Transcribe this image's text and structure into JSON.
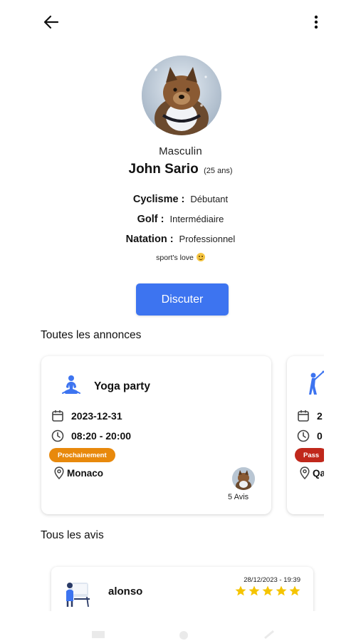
{
  "topbar": {
    "back_icon": "arrow-left-icon",
    "more_icon": "more-vertical-icon"
  },
  "profile": {
    "gender": "Masculin",
    "name": "John Sario",
    "age": "(25 ans)",
    "sports": [
      {
        "name": "Cyclisme :",
        "level": "Débutant"
      },
      {
        "name": "Golf :",
        "level": "Intermédiaire"
      },
      {
        "name": "Natation :",
        "level": "Professionnel"
      }
    ],
    "bio": "sport's love"
  },
  "actions": {
    "chat_label": "Discuter"
  },
  "announcements": {
    "title": "Toutes les annonces",
    "items": [
      {
        "category_icon": "yoga-icon",
        "title": "Yoga party",
        "date": "2023-12-31",
        "time": "08:20 - 20:00",
        "status": "Prochainement",
        "status_color": "#e8890c",
        "location": "Monaco",
        "reviews": "5 Avis"
      },
      {
        "category_icon": "golf-icon",
        "title": "",
        "date": "2",
        "time": "0",
        "status": "Pass",
        "status_color": "#c0281c",
        "location": "Qa",
        "reviews": ""
      }
    ]
  },
  "reviews": {
    "title": "Tous les avis",
    "items": [
      {
        "author": "alonso",
        "date": "28/12/2023 - 19:39",
        "rating": 5,
        "star_color": "#f5c400"
      }
    ]
  },
  "colors": {
    "primary": "#3d74f0",
    "icon_blue": "#3d74f0"
  }
}
